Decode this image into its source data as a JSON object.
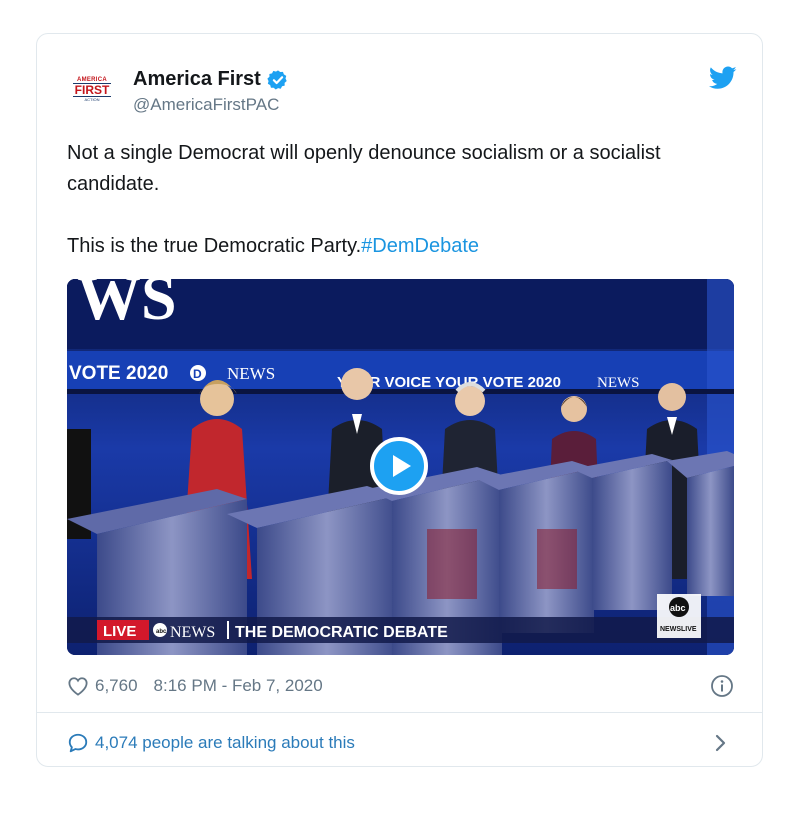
{
  "tweet": {
    "author": {
      "name": "America First",
      "handle": "@AmericaFirstPAC",
      "avatar_text": {
        "line1": "AMERICA",
        "line2": "FIRST",
        "line3": "ACTION"
      }
    },
    "text_line1": "Not a single Democrat will openly denounce socialism or a socialist candidate.",
    "text_line2_plain": "This is the true Democratic Party.",
    "hashtag": "#DemDebate",
    "likes": "6,760",
    "timestamp": "8:16 PM - Feb 7, 2020",
    "conversation": "4,074 people are talking about this"
  },
  "media": {
    "banner_top": "WS",
    "banner_left": "VOTE 2020",
    "banner_left_news": "NEWS",
    "banner_center": "YOUR VOICE YOUR VOTE 2020",
    "banner_right": "NEWS",
    "lower_third_live": "LIVE",
    "lower_third_network": "NEWS",
    "lower_third_title": "THE DEMOCRATIC DEBATE",
    "bug_top": "abc",
    "bug_bottom": "NEWSLIVE"
  },
  "colors": {
    "verified_blue": "#1da1f2",
    "link_blue": "#1b95e0",
    "muted_gray": "#657786"
  },
  "icons": [
    "verified-badge-icon",
    "twitter-bird-icon",
    "play-icon",
    "heart-icon",
    "info-icon",
    "reply-bubble-icon",
    "chevron-right-icon"
  ]
}
